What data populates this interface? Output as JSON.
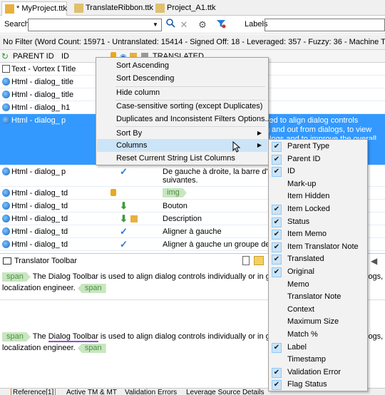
{
  "tabs": [
    {
      "label": "* MyProject.ttk",
      "active": true
    },
    {
      "label": "TranslateRibbon.ttk",
      "active": false
    },
    {
      "label": "Project_A1.ttk",
      "active": false
    }
  ],
  "toolbar": {
    "search_label": "Search",
    "search_value": "",
    "labels_label": "Labels",
    "labels_value": ""
  },
  "filter_status": "No Filter (Word Count: 15971 - Untranslated: 15414 - Signed Off: 18 - Leveraged: 357 - Fuzzy: 36 - Machine Translated: 146)",
  "grid": {
    "headers": {
      "parent_id": "PARENT ID",
      "id": "ID",
      "translated": "TRANSLATED"
    },
    "rows": [
      {
        "icon": "text",
        "parent_id": "Text - Vortex De",
        "id": "Title",
        "translated": "",
        "status": "",
        "lock": false
      },
      {
        "icon": "html",
        "parent_id": "Html - dialog_t",
        "id": "title",
        "translated": "",
        "status": "",
        "lock": false
      },
      {
        "icon": "html",
        "parent_id": "Html - dialog_t",
        "id": "title",
        "translated": "",
        "status": "",
        "lock": false
      },
      {
        "icon": "html",
        "parent_id": "Html - dialog_t",
        "id": "h1",
        "translated": "",
        "status": "",
        "lock": false
      },
      {
        "icon": "html",
        "parent_id": "Html - dialog_t",
        "id": "p",
        "translated": "sed to align dialog controls",
        "translated2": "n and out from dialogs, to view",
        "translated3": "alogs and to improve the overall",
        "status": "",
        "lock": false,
        "selected": true
      },
      {
        "icon": "html",
        "parent_id": "Html - dialog_t",
        "id": "p",
        "translated": "De gauche à droite, la barre d'o",
        "translated2": "suivantes.",
        "status": "✓",
        "lock": false
      },
      {
        "icon": "html",
        "parent_id": "Html - dialog_t",
        "id": "td",
        "translated": "img",
        "status": "",
        "lock": true
      },
      {
        "icon": "html",
        "parent_id": "Html - dialog_t",
        "id": "td",
        "translated": "Bouton",
        "status": "⬇",
        "lock": false
      },
      {
        "icon": "html",
        "parent_id": "Html - dialog_t",
        "id": "td",
        "translated": "Description",
        "status": "⬇",
        "lock": false
      },
      {
        "icon": "html",
        "parent_id": "Html - dialog_t",
        "id": "td",
        "translated": "Aligner à gauche",
        "status": "✓",
        "lock": false
      },
      {
        "icon": "html",
        "parent_id": "Html - dialog_t",
        "id": "td",
        "translated": "Aligner à gauche un groupe de",
        "status": "✓",
        "lock": false
      }
    ]
  },
  "context_menu": {
    "items": [
      {
        "label": "Sort Ascending"
      },
      {
        "label": "Sort Descending"
      },
      {
        "label": "Hide column"
      },
      {
        "label": "Case-sensitive sorting (except Duplicates)"
      },
      {
        "label": "Duplicates and Inconsistent Filters Options..."
      },
      {
        "label": "Sort By"
      },
      {
        "label": "Columns"
      },
      {
        "label": "Reset Current String List Columns"
      }
    ]
  },
  "columns_submenu": [
    {
      "label": "Parent Type",
      "checked": true
    },
    {
      "label": "Parent ID",
      "checked": true
    },
    {
      "label": "ID",
      "checked": true
    },
    {
      "label": "Mark-up",
      "checked": false
    },
    {
      "label": "Item Hidden",
      "checked": false
    },
    {
      "label": "Item Locked",
      "checked": true
    },
    {
      "label": "Status",
      "checked": true
    },
    {
      "label": "Item Memo",
      "checked": true
    },
    {
      "label": "Item Translator Note",
      "checked": true
    },
    {
      "label": "Translated",
      "checked": true
    },
    {
      "label": "Original",
      "checked": true
    },
    {
      "label": "Memo",
      "checked": false
    },
    {
      "label": "Translator Note",
      "checked": false
    },
    {
      "label": "Context",
      "checked": false
    },
    {
      "label": "Maximum Size",
      "checked": false
    },
    {
      "label": "Match %",
      "checked": false
    },
    {
      "label": "Label",
      "checked": true
    },
    {
      "label": "Timestamp",
      "checked": false
    },
    {
      "label": "Validation Error",
      "checked": true
    },
    {
      "label": "Flag Status",
      "checked": true
    }
  ],
  "translator_toolbar": {
    "title": "Translator Toolbar",
    "tag_label": "span",
    "text1a": "The Dialog Toolbar is used to align dialog controls individually or in gro",
    "text1b": "logs,",
    "text1c": "localization engineer.",
    "text2a": "The ",
    "text2b": "Dialog Toolbar",
    "text2c": " is used to align dialog controls individually or in gro",
    "text2d": "logs,",
    "text2e": "localization engineer."
  },
  "bottom_tabs": [
    {
      "label": "Reference[1]",
      "active": true
    },
    {
      "label": "Active TM & MT",
      "active": false
    },
    {
      "label": "Validation Errors",
      "active": false
    },
    {
      "label": "Leverage Source Details",
      "active": false
    }
  ],
  "colors": {
    "selection": "#3399ff",
    "check": "#2a7ad5",
    "tag_bg": "#c8e6c0",
    "menu_bg": "#f2f2f2"
  }
}
